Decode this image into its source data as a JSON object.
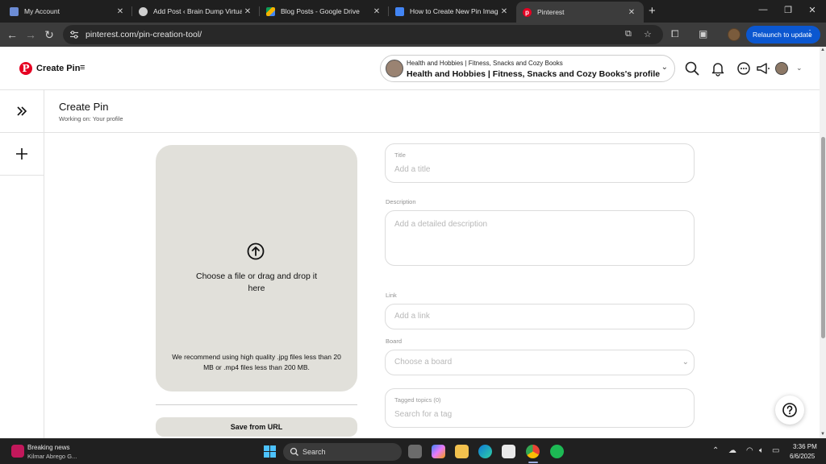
{
  "browser": {
    "tabs": [
      {
        "title": "My Account",
        "favicon": "account-favicon",
        "color": "#6c8cd5"
      },
      {
        "title": "Add Post ‹ Brain Dump Virtual ·",
        "favicon": "wordpress-favicon",
        "color": "#cfcfcf"
      },
      {
        "title": "Blog Posts - Google Drive",
        "favicon": "google-drive-favicon",
        "color": "#f4b400"
      },
      {
        "title": "How to Create New Pin Images",
        "favicon": "google-docs-favicon",
        "color": "#4285f4"
      },
      {
        "title": "Pinterest",
        "favicon": "pinterest-favicon",
        "color": "#e60023",
        "active": true
      }
    ],
    "url": "pinterest.com/pin-creation-tool/",
    "relaunch_label": "Relaunch to update"
  },
  "pinterest": {
    "brand_color": "#e60023",
    "header": {
      "title": "Create Pin",
      "profile_small": "Health and Hobbies | Fitness, Snacks and Cozy Books",
      "profile_main": "Health and Hobbies | Fitness, Snacks and Cozy Books's profile"
    },
    "subheader": {
      "title": "Create Pin",
      "working_on": "Working on: Your profile"
    },
    "upload": {
      "prompt": "Choose a file or drag and drop it here",
      "recommendation": "We recommend using high quality .jpg files less than 20 MB or .mp4 files less than 200 MB.",
      "save_from_url": "Save from URL"
    },
    "form": {
      "title_label": "Title",
      "title_placeholder": "Add a title",
      "description_label": "Description",
      "description_placeholder": "Add a detailed description",
      "link_label": "Link",
      "link_placeholder": "Add a link",
      "board_label": "Board",
      "board_placeholder": "Choose a board",
      "topics_label": "Tagged topics (0)",
      "topics_placeholder": "Search for a tag"
    }
  },
  "taskbar": {
    "news_title": "Breaking news",
    "news_subtitle": "Kilmar Abrego G...",
    "search_label": "Search",
    "time": "3:36 PM",
    "date": "6/6/2025"
  }
}
